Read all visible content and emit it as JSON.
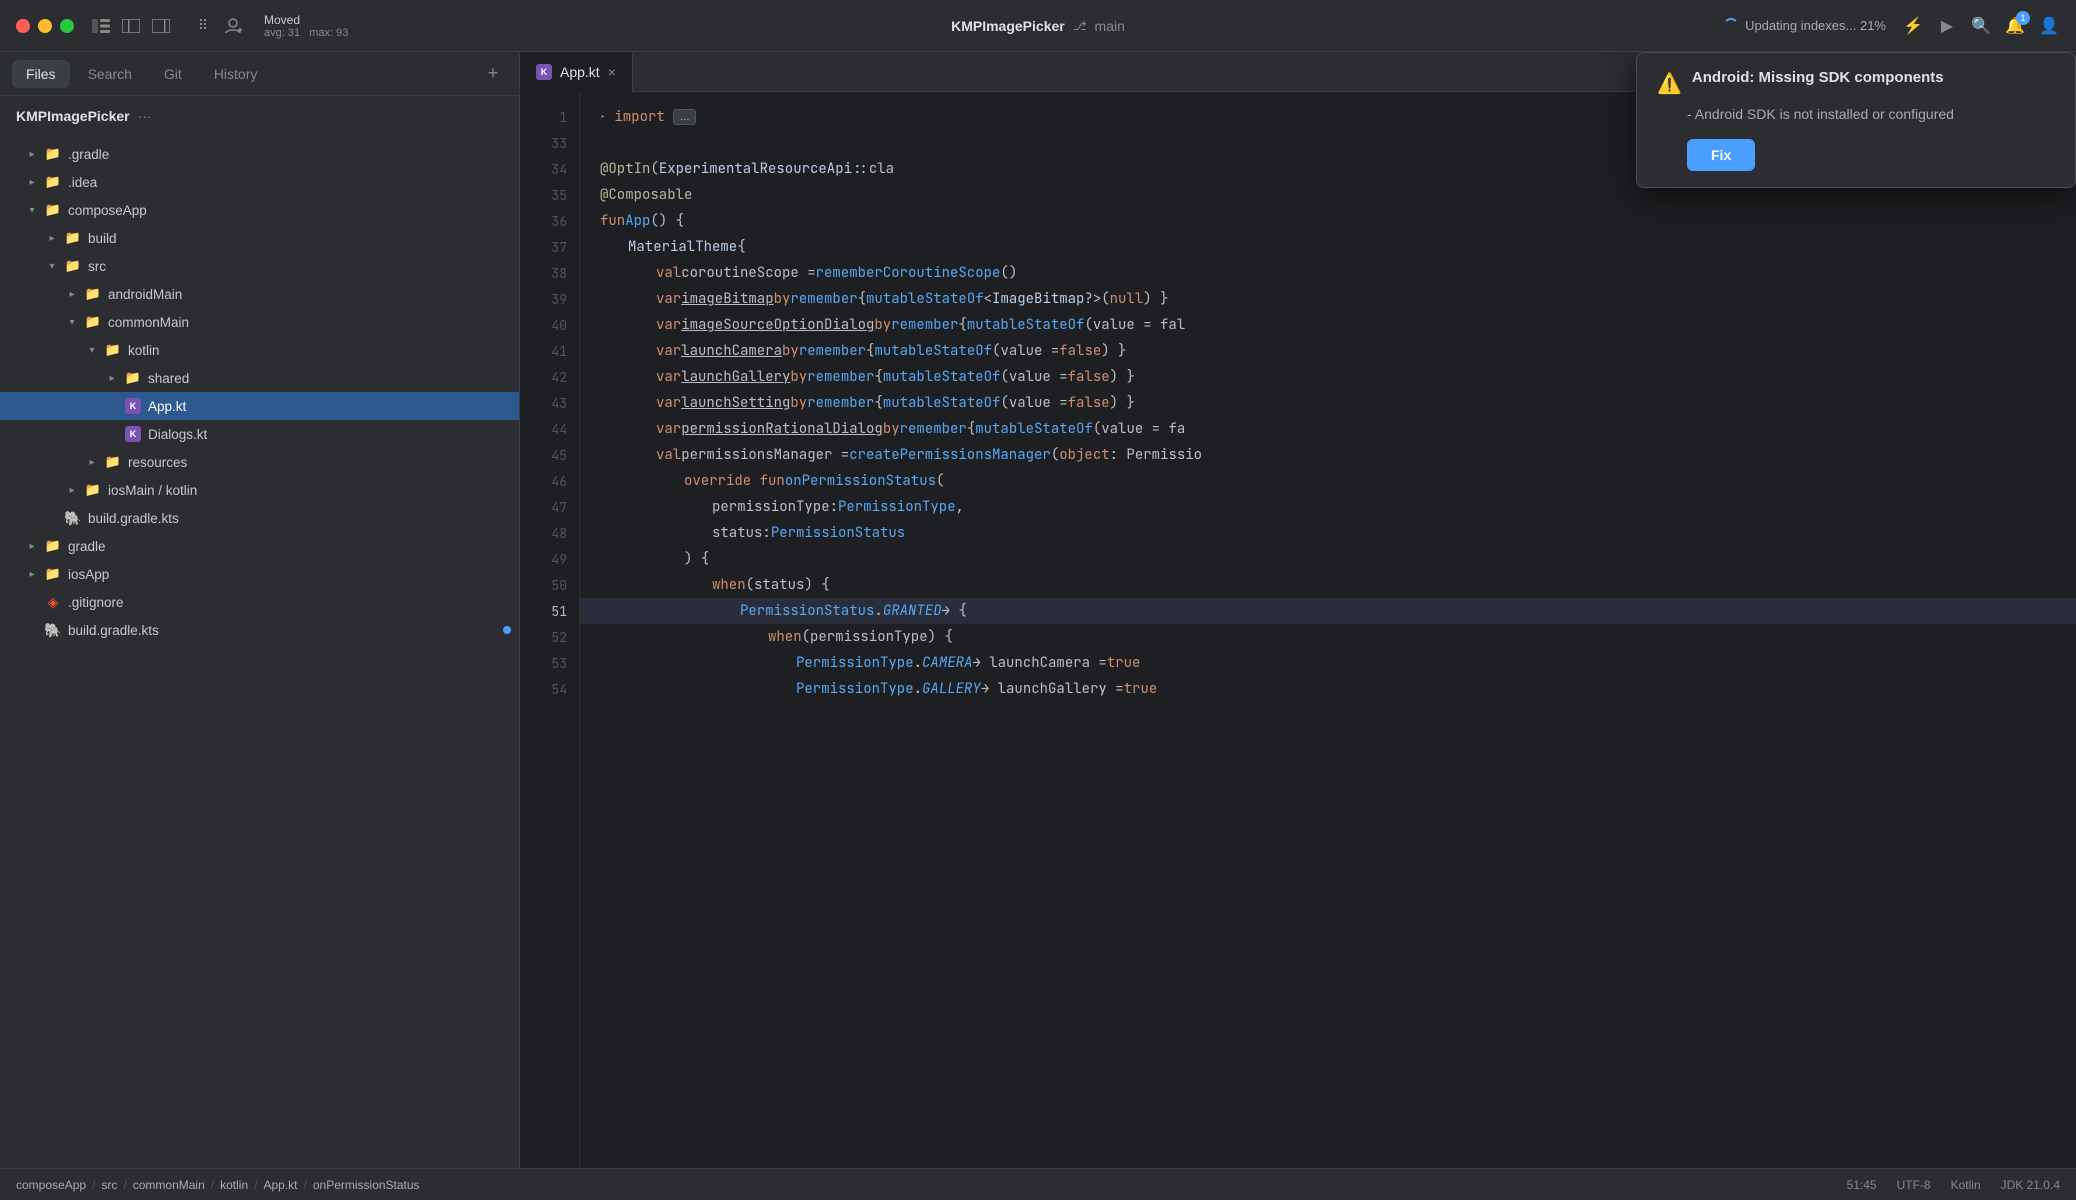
{
  "titlebar": {
    "traffic": [
      "red",
      "yellow",
      "green"
    ],
    "moved_label": "Moved",
    "avg_label": "avg: 31",
    "max_label": "max: 93",
    "project": "KMPImagePicker",
    "branch": "main",
    "indexing": "Updating indexes... 21%",
    "notification_count": "1"
  },
  "sidebar": {
    "tabs": [
      "Files",
      "Search",
      "Git",
      "History"
    ],
    "active_tab": "Files",
    "add_tab_label": "+",
    "header_title": "KMPImagePicker",
    "header_dots": "···",
    "tree": [
      {
        "label": ".gradle",
        "level": 1,
        "type": "folder",
        "state": "closed"
      },
      {
        "label": ".idea",
        "level": 1,
        "type": "folder",
        "state": "closed"
      },
      {
        "label": "composeApp",
        "level": 1,
        "type": "folder",
        "state": "open"
      },
      {
        "label": "build",
        "level": 2,
        "type": "folder",
        "state": "closed"
      },
      {
        "label": "src",
        "level": 2,
        "type": "folder",
        "state": "open"
      },
      {
        "label": "androidMain",
        "level": 3,
        "type": "folder",
        "state": "closed"
      },
      {
        "label": "commonMain",
        "level": 3,
        "type": "folder",
        "state": "open"
      },
      {
        "label": "kotlin",
        "level": 4,
        "type": "folder",
        "state": "open"
      },
      {
        "label": "shared",
        "level": 5,
        "type": "folder",
        "state": "closed"
      },
      {
        "label": "App.kt",
        "level": 5,
        "type": "kotlin",
        "state": "none",
        "selected": true
      },
      {
        "label": "Dialogs.kt",
        "level": 5,
        "type": "kotlin",
        "state": "none"
      },
      {
        "label": "resources",
        "level": 4,
        "type": "folder",
        "state": "closed"
      },
      {
        "label": "iosMain / kotlin",
        "level": 3,
        "type": "folder",
        "state": "closed"
      },
      {
        "label": "build.gradle.kts",
        "level": 2,
        "type": "gradle",
        "state": "none"
      },
      {
        "label": "gradle",
        "level": 1,
        "type": "folder",
        "state": "closed"
      },
      {
        "label": "iosApp",
        "level": 1,
        "type": "folder",
        "state": "closed"
      },
      {
        "label": ".gitignore",
        "level": 1,
        "type": "gitignore",
        "state": "none"
      },
      {
        "label": "build.gradle.kts",
        "level": 1,
        "type": "gradle",
        "state": "none",
        "modified": true
      }
    ]
  },
  "editor": {
    "tab_filename": "App.kt",
    "lines": [
      {
        "num": "1",
        "content": "import_collapsed"
      },
      {
        "num": "33",
        "content": "empty"
      },
      {
        "num": "34",
        "content": "@OptIn(ExperimentalResourceApi::cla"
      },
      {
        "num": "35",
        "content": "@Composable"
      },
      {
        "num": "36",
        "content": "fun App() {"
      },
      {
        "num": "37",
        "content": "    MaterialTheme {"
      },
      {
        "num": "38",
        "content": "        val coroutineScope = rememberCoroutineScope()"
      },
      {
        "num": "39",
        "content": "        var imageBitmap by remember { mutableStateOf<ImageBitmap?>(null) }"
      },
      {
        "num": "40",
        "content": "        var imageSourceOptionDialog by remember { mutableStateOf(value = fal"
      },
      {
        "num": "41",
        "content": "        var launchCamera by remember { mutableStateOf(value = false) }"
      },
      {
        "num": "42",
        "content": "        var launchGallery by remember { mutableStateOf(value = false) }"
      },
      {
        "num": "43",
        "content": "        var launchSetting by remember { mutableStateOf(value = false) }"
      },
      {
        "num": "44",
        "content": "        var permissionRationalDialog by remember { mutableStateOf(value = fa"
      },
      {
        "num": "45",
        "content": "        val permissionsManager = createPermissionsManager(object : Permissio"
      },
      {
        "num": "46",
        "content": "            override fun onPermissionStatus("
      },
      {
        "num": "47",
        "content": "                permissionType: PermissionType,"
      },
      {
        "num": "48",
        "content": "                status: PermissionStatus"
      },
      {
        "num": "49",
        "content": "            ) {"
      },
      {
        "num": "50",
        "content": "                when (status) {"
      },
      {
        "num": "51",
        "content": "                    PermissionStatus.GRANTED → {",
        "highlighted": true
      },
      {
        "num": "52",
        "content": "                        when (permissionType) {"
      },
      {
        "num": "53",
        "content": "                            PermissionType.CAMERA → launchCamera = true"
      },
      {
        "num": "54",
        "content": "                            PermissionType.GALLERY → launchGallery = true"
      }
    ]
  },
  "popup": {
    "title": "Android: Missing SDK components",
    "body": "- Android SDK is not installed or configured",
    "fix_label": "Fix"
  },
  "statusbar": {
    "breadcrumb": [
      "composeApp",
      "/",
      "src",
      "/",
      "commonMain",
      "/",
      "kotlin",
      "/",
      "App.kt",
      "/",
      "onPermissionStatus"
    ],
    "position": "51:45",
    "encoding": "UTF-8",
    "language": "Kotlin",
    "jdk": "JDK 21.0.4"
  }
}
